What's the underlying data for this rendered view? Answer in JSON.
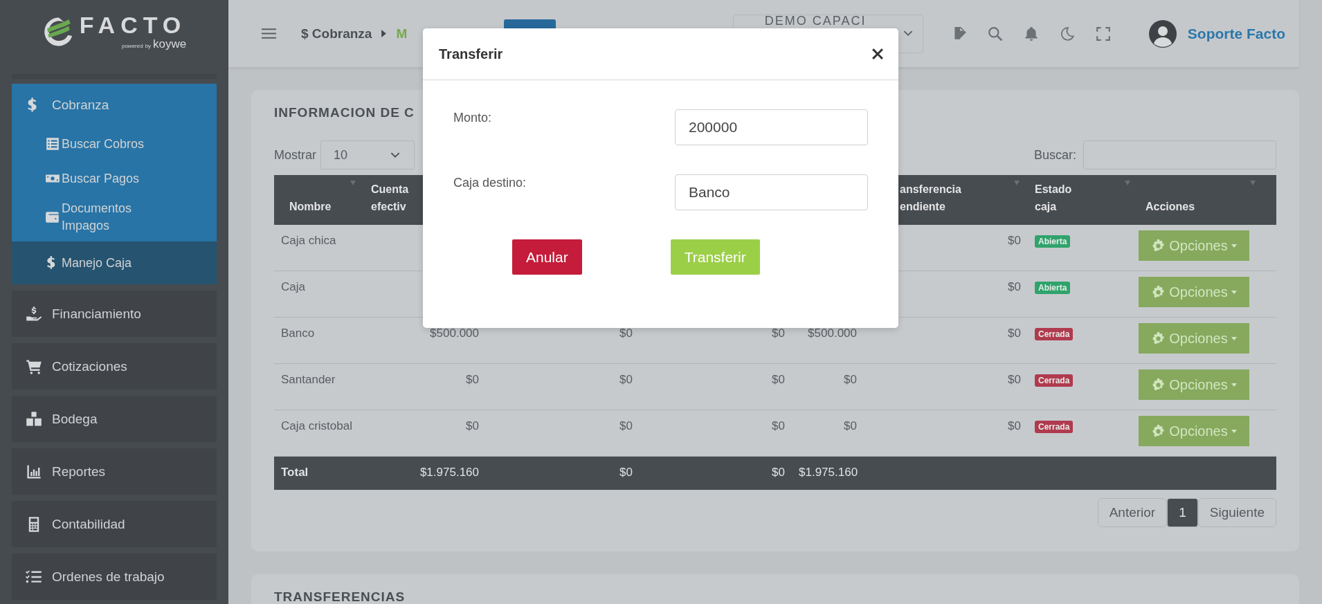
{
  "sidebar": {
    "logo": {
      "name": "FACTO",
      "tagline_1": "powered",
      "tagline_2": "by",
      "tagline_3": "koywe"
    },
    "items": [
      {
        "label": "Cobranza",
        "expanded": true,
        "children": [
          {
            "label": "Buscar Cobros",
            "selected": false
          },
          {
            "label": "Buscar Pagos",
            "selected": false
          },
          {
            "label": "Documentos Impagos",
            "selected": false
          },
          {
            "label": "Manejo Caja",
            "selected": true
          }
        ]
      },
      {
        "label": "Financiamiento"
      },
      {
        "label": "Cotizaciones"
      },
      {
        "label": "Bodega"
      },
      {
        "label": "Reportes"
      },
      {
        "label": "Contabilidad"
      },
      {
        "label": "Ordenes de trabajo"
      }
    ]
  },
  "topbar": {
    "breadcrumb": [
      "$ Cobranza",
      "M"
    ],
    "company_select": "DEMO CAPACI",
    "user": "Soporte Facto"
  },
  "card": {
    "title": "INFORMACION DE C",
    "show_label": "Mostrar",
    "page_size": "10",
    "search_label": "Buscar:",
    "columns": [
      {
        "lines": [
          "Nombre"
        ]
      },
      {
        "lines": [
          "Cuenta",
          "efectiv"
        ]
      },
      {
        "lines": [
          "ansferencia",
          "endiente"
        ]
      },
      {
        "lines": [
          "Estado",
          "caja"
        ]
      },
      {
        "lines": [
          "Acciones"
        ]
      }
    ],
    "rows": [
      {
        "name": "Caja chica",
        "values": [
          "$0"
        ],
        "status": "Abierta",
        "color": "#2fa36b",
        "action": "Opciones"
      },
      {
        "name": "Caja",
        "values": [
          "$0"
        ],
        "status": "Abierta",
        "color": "#2fa36b",
        "action": "Opciones"
      },
      {
        "name": "Banco",
        "values": [
          "$500.000",
          "$0",
          "$0",
          "$500.000",
          "$0"
        ],
        "status": "Cerrada",
        "color": "#b03a4e",
        "action": "Opciones"
      },
      {
        "name": "Santander",
        "values": [
          "$0",
          "$0",
          "$0",
          "$0",
          "$0"
        ],
        "status": "Cerrada",
        "color": "#b03a4e",
        "action": "Opciones"
      },
      {
        "name": "Caja cristobal",
        "values": [
          "$0",
          "$0",
          "$0",
          "$0",
          "$0"
        ],
        "status": "Cerrada",
        "color": "#b03a4e",
        "action": "Opciones"
      }
    ],
    "total": {
      "label": "Total",
      "values": [
        "$1.975.160",
        "$0",
        "$0",
        "$1.975.160"
      ]
    },
    "pagination": [
      {
        "label": "Anterior",
        "selected": false
      },
      {
        "label": "1",
        "selected": true
      },
      {
        "label": "Siguiente",
        "selected": false
      }
    ]
  },
  "second_card": {
    "title": "TRANSFERENCIAS"
  },
  "modal": {
    "title": "Transferir",
    "fields": [
      {
        "label": "Monto:",
        "value": "200000"
      },
      {
        "label": "Caja destino:",
        "value": "Banco"
      }
    ],
    "buttons": [
      {
        "label": "Anular",
        "kind": "danger"
      },
      {
        "label": "Transferir",
        "kind": "success"
      }
    ]
  }
}
